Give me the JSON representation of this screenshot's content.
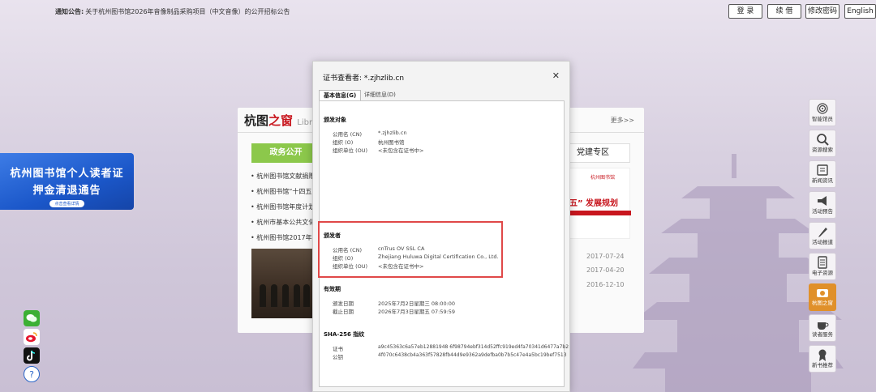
{
  "top": {
    "notice_label": "通知公告:",
    "notice_text": "关于杭州图书馆2026年音像制品采购项目（中文音像）的公开招标公告",
    "login": "登 录",
    "renew": "续 借",
    "change_pwd": "修改密码",
    "english": "English"
  },
  "banner": {
    "line1": "杭州图书馆个人读者证",
    "line2": "押金清退通告",
    "cta": "点击查看详情"
  },
  "card": {
    "title_a": "杭图",
    "title_b": "之窗",
    "title_c": "Libra",
    "more": "更多>>",
    "tab_gov": "政务公开",
    "tab_party": "党建专区",
    "news": [
      "杭州图书馆文献捐赠",
      "杭州图书馆“十四五",
      "杭州图书馆年度计划",
      "杭州市基本公共文化",
      "杭州图书馆2017年"
    ],
    "dates": [
      "2017-07-24",
      "2017-04-20",
      "2016-12-10"
    ],
    "plan_logo": "杭州图书馆",
    "plan_text": "五” 发展规划"
  },
  "dialog": {
    "title": "证书查看者: *.zjhzlib.cn",
    "tab_general": "基本信息(G)",
    "tab_details": "详细信息(D)",
    "issued_to": {
      "heading": "颁发对象",
      "fields": [
        {
          "k": "公用名 (CN)",
          "v": "*.zjhzlib.cn"
        },
        {
          "k": "组织 (O)",
          "v": "杭州图书馆"
        },
        {
          "k": "组织单位 (OU)",
          "v": "<未包含在证书中>"
        }
      ]
    },
    "issued_by": {
      "heading": "颁发者",
      "fields": [
        {
          "k": "公用名 (CN)",
          "v": "cnTrus OV SSL CA"
        },
        {
          "k": "组织 (O)",
          "v": "Zhejiang Huluwa Digital Certification Co., Ltd."
        },
        {
          "k": "组织单位 (OU)",
          "v": "<未包含在证书中>"
        }
      ]
    },
    "validity": {
      "heading": "有效期",
      "fields": [
        {
          "k": "颁发日期",
          "v": "2025年7月2日星期三 08:00:00"
        },
        {
          "k": "截止日期",
          "v": "2026年7月3日星期五 07:59:59"
        }
      ]
    },
    "fingerprints": {
      "heading": "SHA-256 指纹",
      "fields": [
        {
          "k": "证书",
          "v": "a9c45363c6a57eb12881948 6f98794ebf314d52ffc919ed4fa70341d6477a7b2"
        },
        {
          "k": "公钥",
          "v": "4f070c6438cb4a363f57828fb44d9e9362a9defba0b7b5c47e4a5bc19bef7513"
        }
      ]
    }
  },
  "sidebar": [
    {
      "label": "智能馆员",
      "icon": "fingerprint-icon"
    },
    {
      "label": "资源搜索",
      "icon": "search-icon"
    },
    {
      "label": "新闻资讯",
      "icon": "newspaper-icon"
    },
    {
      "label": "活动预告",
      "icon": "megaphone-icon"
    },
    {
      "label": "活动报道",
      "icon": "pen-icon"
    },
    {
      "label": "电子资源",
      "icon": "database-icon"
    },
    {
      "label": "杭图之窗",
      "icon": "camera-icon"
    },
    {
      "label": "读者服务",
      "icon": "coffee-icon"
    },
    {
      "label": "新书推荐",
      "icon": "award-icon"
    }
  ],
  "colors": {
    "accent_green": "#8cc84b",
    "highlight_red": "#e04848",
    "sidebar_active": "#e0902a",
    "banner_blue": "#1b57c9"
  }
}
